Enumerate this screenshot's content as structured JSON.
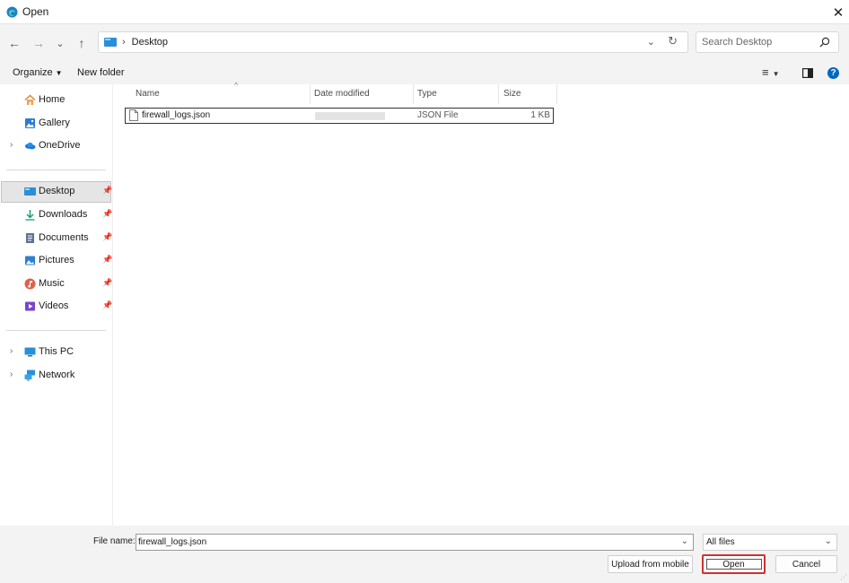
{
  "window": {
    "title": "Open",
    "close_glyph": "✕",
    "app_icon": "edge-icon"
  },
  "nav": {
    "back_icon": "←",
    "forward_icon": "→",
    "recent_icon": "⌄",
    "up_icon": "↑",
    "address": {
      "separator": "›",
      "location": "Desktop",
      "dropdown_icon": "⌄",
      "refresh_icon": "↻"
    },
    "search": {
      "placeholder": "Search Desktop"
    }
  },
  "toolbar": {
    "organize_label": "Organize",
    "dropdown_glyph": "▼",
    "new_folder_label": "New folder",
    "view_icon": "≡",
    "help_glyph": "?"
  },
  "sidebar": {
    "items": [
      {
        "label": "Home",
        "icon": "home-icon"
      },
      {
        "label": "Gallery",
        "icon": "gallery-icon"
      },
      {
        "label": "OneDrive",
        "icon": "onedrive-icon",
        "expand": "›"
      },
      {
        "label": "Desktop",
        "icon": "desktop-icon",
        "pin": "📌",
        "selected": true
      },
      {
        "label": "Downloads",
        "icon": "downloads-icon",
        "pin": "📌"
      },
      {
        "label": "Documents",
        "icon": "documents-icon",
        "pin": "📌"
      },
      {
        "label": "Pictures",
        "icon": "pictures-icon",
        "pin": "📌"
      },
      {
        "label": "Music",
        "icon": "music-icon",
        "pin": "📌"
      },
      {
        "label": "Videos",
        "icon": "videos-icon",
        "pin": "📌"
      },
      {
        "label": "This PC",
        "icon": "this-pc-icon",
        "expand": "›"
      },
      {
        "label": "Network",
        "icon": "network-icon",
        "expand": "›"
      }
    ]
  },
  "files": {
    "columns": [
      "Name",
      "Date modified",
      "Type",
      "Size"
    ],
    "sort_caret": "^",
    "rows": [
      {
        "name": "firewall_logs.json",
        "type": "JSON File",
        "size": "1 KB"
      }
    ]
  },
  "footer": {
    "file_name_label": "File name:",
    "file_name_value": "firewall_logs.json",
    "combo_arrow": "⌄",
    "filter": "All files",
    "upload_label": "Upload from mobile",
    "open_label": "Open",
    "cancel_label": "Cancel"
  },
  "colors": {
    "accent": "#0067c0",
    "highlight": "#d03030"
  }
}
